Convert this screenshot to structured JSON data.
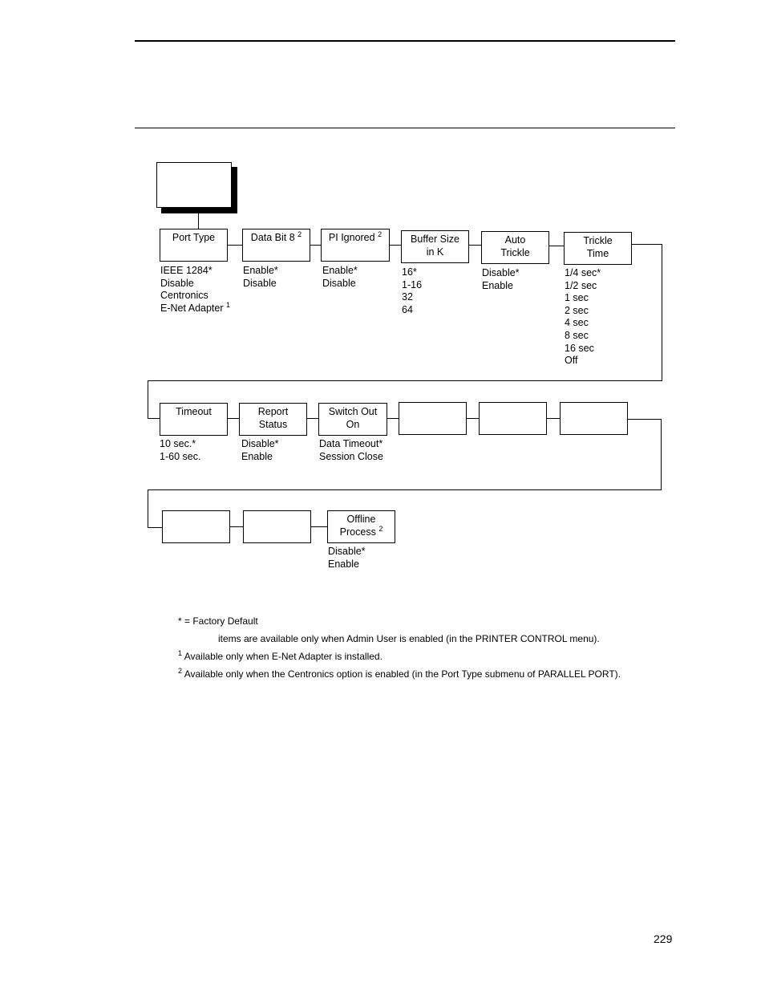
{
  "row1": [
    {
      "label": "Port Type",
      "sup": "",
      "values": [
        "IEEE 1284*",
        "Disable",
        "Centronics",
        "E-Net Adapter"
      ],
      "last_sup": "1"
    },
    {
      "label": "Data Bit 8",
      "sup": "2",
      "values": [
        "Enable*",
        "Disable"
      ]
    },
    {
      "label": "PI Ignored",
      "sup": "2",
      "values": [
        "Enable*",
        "Disable"
      ]
    },
    {
      "label": "Buffer Size",
      "label2": "in K",
      "values": [
        "16*",
        "1-16",
        "32",
        "64"
      ]
    },
    {
      "label": "Auto",
      "label2": "Trickle",
      "values": [
        "Disable*",
        "Enable"
      ]
    },
    {
      "label": "Trickle",
      "label2": "Time",
      "values": [
        "1/4 sec*",
        "1/2 sec",
        "1 sec",
        "2 sec",
        "4 sec",
        "8 sec",
        "16 sec",
        "Off"
      ]
    }
  ],
  "row2": [
    {
      "label": "Timeout",
      "values": [
        "10 sec.*",
        "1-60 sec."
      ]
    },
    {
      "label": "Report",
      "label2": "Status",
      "values": [
        "Disable*",
        "Enable"
      ]
    },
    {
      "label": "Switch Out",
      "label2": "On",
      "values": [
        "Data Timeout*",
        "Session Close"
      ]
    }
  ],
  "row3": [
    {
      "label": "Offline",
      "label2": "Process",
      "sup": "2",
      "values": [
        "Disable*",
        "Enable"
      ]
    }
  ],
  "notes": {
    "factory": "* = Factory Default",
    "admin": "items are available only when Admin User is enabled (in the PRINTER CONTROL menu).",
    "n1_sup": "1",
    "n1": "Available only when E-Net Adapter is installed.",
    "n2_sup": "2",
    "n2": "Available only when the Centronics option is enabled (in the Port Type submenu of PARALLEL PORT)."
  },
  "page_number": "229"
}
